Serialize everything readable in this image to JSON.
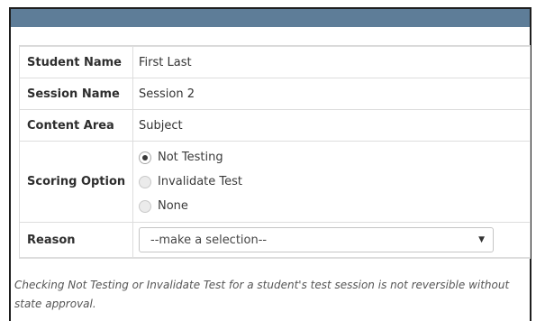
{
  "form": {
    "rows": {
      "student_name": {
        "label": "Student Name",
        "value": "First Last"
      },
      "session_name": {
        "label": "Session Name",
        "value": "Session 2"
      },
      "content_area": {
        "label": "Content Area",
        "value": "Subject"
      },
      "scoring_option": {
        "label": "Scoring Option",
        "options": [
          {
            "label": "Not Testing",
            "checked": true
          },
          {
            "label": "Invalidate Test",
            "checked": false
          },
          {
            "label": "None",
            "checked": false
          }
        ]
      },
      "reason": {
        "label": "Reason",
        "selected": "--make a selection--",
        "arrow_icon": "triangle-down"
      }
    }
  },
  "note": "Checking Not Testing or Invalidate Test for a student's test session is not reversible without state approval.",
  "colors": {
    "header_bar": "#5e7d98",
    "frame": "#1e1e1e",
    "border": "#dddddd"
  }
}
